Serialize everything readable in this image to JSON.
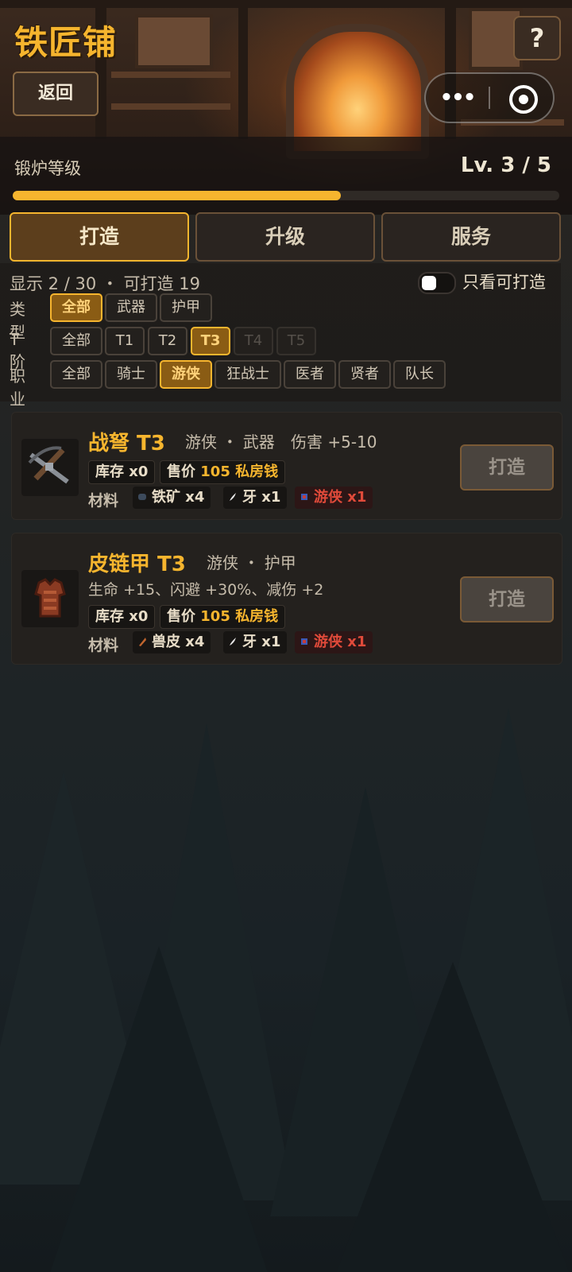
{
  "header": {
    "title": "铁匠铺",
    "help_label": "?",
    "back_label": "返回",
    "forge_label": "锻炉等级",
    "forge_level_text": "Lv. 3 / 5",
    "forge_progress": 0.6,
    "accent_color": "#f6b52e"
  },
  "tabs": [
    {
      "label": "打造",
      "active": true
    },
    {
      "label": "升级",
      "active": false
    },
    {
      "label": "服务",
      "active": false
    }
  ],
  "filters": {
    "summary": "显示 2 / 30 ・ 可打造 19",
    "only_craftable_label": "只看可打造",
    "only_craftable_on": false,
    "type": {
      "label": "类型",
      "options": [
        "全部",
        "武器",
        "护甲"
      ],
      "selected": "全部"
    },
    "tier": {
      "label": "T阶",
      "options": [
        "全部",
        "T1",
        "T2",
        "T3",
        "T4",
        "T5"
      ],
      "selected": "T3",
      "disabled": [
        "T4",
        "T5"
      ]
    },
    "class": {
      "label": "职业",
      "options": [
        "全部",
        "骑士",
        "游侠",
        "狂战士",
        "医者",
        "贤者",
        "队长"
      ],
      "selected": "游侠"
    }
  },
  "recipes": [
    {
      "name": "战弩 T3",
      "meta": "游侠 ・ 武器",
      "stats": "伤害 +5-10",
      "stock_label": "库存",
      "stock_value": "x0",
      "price_label": "售价",
      "price_value": "105 私房钱",
      "materials_label": "材料",
      "materials": [
        {
          "name": "铁矿",
          "qty": "x4",
          "icon": "iron-ore-icon",
          "missing": false
        },
        {
          "name": "牙",
          "qty": "x1",
          "icon": "fang-icon",
          "missing": false
        },
        {
          "name": "游侠",
          "qty": "x1",
          "icon": "ranger-token-icon",
          "missing": true
        }
      ],
      "icon": "crossbow-icon",
      "craft_label": "打造"
    },
    {
      "name": "皮链甲 T3",
      "meta": "游侠 ・ 护甲",
      "stats": "生命 +15、闪避 +30%、减伤 +2",
      "stock_label": "库存",
      "stock_value": "x0",
      "price_label": "售价",
      "price_value": "105 私房钱",
      "materials_label": "材料",
      "materials": [
        {
          "name": "兽皮",
          "qty": "x4",
          "icon": "hide-icon",
          "missing": false
        },
        {
          "name": "牙",
          "qty": "x1",
          "icon": "fang-icon",
          "missing": false
        },
        {
          "name": "游侠",
          "qty": "x1",
          "icon": "ranger-token-icon",
          "missing": true
        }
      ],
      "icon": "leather-armor-icon",
      "craft_label": "打造"
    }
  ]
}
